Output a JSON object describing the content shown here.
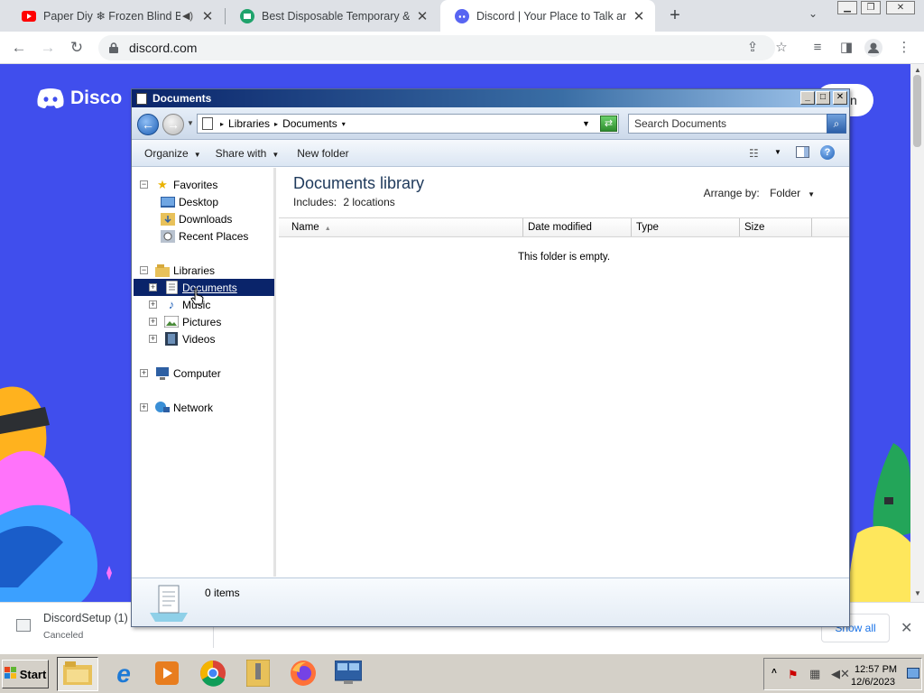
{
  "browser": {
    "tabs": [
      {
        "title": "Paper Diy ❄ Frozen Blind Ba",
        "favicon": "youtube-icon",
        "active": false
      },
      {
        "title": "Best Disposable Temporary & Fal",
        "favicon": "tempmail-icon",
        "active": false
      },
      {
        "title": "Discord | Your Place to Talk and H",
        "favicon": "discord-icon",
        "active": true
      }
    ],
    "new_tab": "+",
    "url": "discord.com"
  },
  "page": {
    "logo_text": "Disco",
    "login_label": "n"
  },
  "explorer": {
    "title": "Documents",
    "breadcrumb": [
      "Libraries",
      "Documents"
    ],
    "search_placeholder": "Search Documents",
    "commands": {
      "organize": "Organize",
      "share_with": "Share with",
      "new_folder": "New folder"
    },
    "nav": {
      "favorites": "Favorites",
      "desktop": "Desktop",
      "downloads": "Downloads",
      "recent_places": "Recent Places",
      "libraries": "Libraries",
      "documents": "Documents",
      "music": "Music",
      "pictures": "Pictures",
      "videos": "Videos",
      "computer": "Computer",
      "network": "Network"
    },
    "library_title": "Documents library",
    "includes_label": "Includes:",
    "includes_link": "2 locations",
    "arrange_label": "Arrange by:",
    "arrange_value": "Folder",
    "columns": [
      "Name",
      "Date modified",
      "Type",
      "Size"
    ],
    "empty_message": "This folder is empty.",
    "item_count": "0 items"
  },
  "downloads": {
    "file_name": "DiscordSetup (1)",
    "status": "Canceled",
    "show_all": "Show all"
  },
  "taskbar": {
    "start": "Start",
    "time": "12:57 PM",
    "date": "12/6/2023"
  }
}
